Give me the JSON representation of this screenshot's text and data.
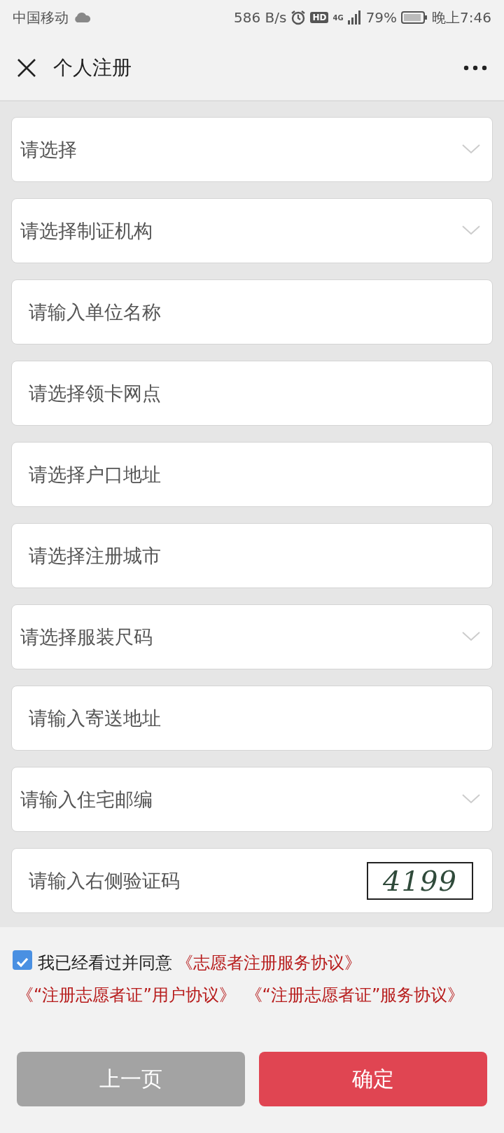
{
  "status_bar": {
    "carrier": "中国移动",
    "speed": "586 B/s",
    "hd": "HD",
    "network": "4G",
    "battery": "79%",
    "time": "晚上7:46"
  },
  "nav": {
    "title": "个人注册"
  },
  "fields": [
    {
      "kind": "select",
      "placeholder": "请选择"
    },
    {
      "kind": "select",
      "placeholder": "请选择制证机构"
    },
    {
      "kind": "input",
      "placeholder": "请输入单位名称"
    },
    {
      "kind": "input",
      "placeholder": "请选择领卡网点"
    },
    {
      "kind": "input",
      "placeholder": "请选择户口地址"
    },
    {
      "kind": "input",
      "placeholder": "请选择注册城市"
    },
    {
      "kind": "select",
      "placeholder": "请选择服装尺码"
    },
    {
      "kind": "input",
      "placeholder": "请输入寄送地址"
    },
    {
      "kind": "select",
      "placeholder": "请输入住宅邮编"
    },
    {
      "kind": "captcha",
      "placeholder": "请输入右侧验证码",
      "code": "4199"
    }
  ],
  "agreement": {
    "checked": true,
    "text": "我已经看过并同意",
    "links": [
      "《志愿者注册服务协议》",
      "《“注册志愿者证”用户协议》",
      "《“注册志愿者证”服务协议》"
    ]
  },
  "buttons": [
    {
      "kind": "secondary",
      "label": "上一页"
    },
    {
      "kind": "primary",
      "label": "确定"
    }
  ]
}
